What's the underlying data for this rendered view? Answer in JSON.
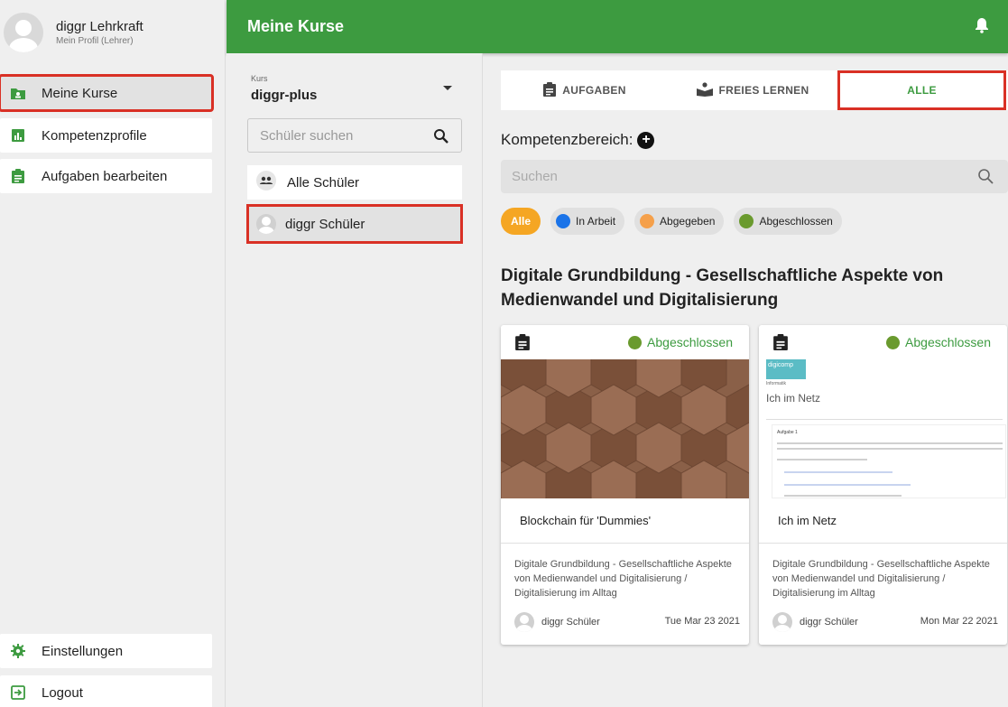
{
  "profile": {
    "name": "diggr Lehrkraft",
    "subtitle": "Mein Profil (Lehrer)"
  },
  "sidebar": {
    "items": [
      {
        "label": "Meine Kurse",
        "icon": "folder-person-icon"
      },
      {
        "label": "Kompetenzprofile",
        "icon": "bar-chart-icon"
      },
      {
        "label": "Aufgaben bearbeiten",
        "icon": "clipboard-icon"
      }
    ],
    "bottom": [
      {
        "label": "Einstellungen",
        "icon": "gear-icon"
      },
      {
        "label": "Logout",
        "icon": "logout-icon"
      }
    ]
  },
  "header": {
    "title": "Meine Kurse"
  },
  "course": {
    "label": "Kurs",
    "value": "diggr-plus"
  },
  "student_search": {
    "placeholder": "Schüler suchen"
  },
  "students": {
    "all": "Alle Schüler",
    "selected": "diggr Schüler"
  },
  "tabs": {
    "aufgaben": "AUFGABEN",
    "freies_lernen": "FREIES LERNEN",
    "alle": "ALLE"
  },
  "kompetenzbereich_label": "Kompetenzbereich:",
  "main_search": {
    "placeholder": "Suchen"
  },
  "filters": {
    "alle": "Alle",
    "in_arbeit": "In Arbeit",
    "abgegeben": "Abgegeben",
    "abgeschlossen": "Abgeschlossen"
  },
  "colors": {
    "green": "#3d9b40",
    "orange": "#f5a623",
    "blue": "#1a73e8",
    "highlight_red": "#d93025"
  },
  "section_title": "Digitale Grundbildung - Gesellschaftliche Aspekte von Medienwandel und Digitalisierung",
  "cards": [
    {
      "status": "Abgeschlossen",
      "title": "Blockchain für 'Dummies'",
      "description": "Digitale Grundbildung - Gesellschaftliche Aspekte von Medienwandel und Digitalisierung / Digitalisierung im Alltag",
      "student": "diggr Schüler",
      "date": "Tue Mar 23 2021"
    },
    {
      "status": "Abgeschlossen",
      "title": "Ich im Netz",
      "description": "Digitale Grundbildung - Gesellschaftliche Aspekte von Medienwandel und Digitalisierung / Digitalisierung im Alltag",
      "student": "diggr Schüler",
      "date": "Mon Mar 22 2021",
      "thumb": {
        "brand": "digicomp",
        "subject": "Informatik",
        "heading": "Ich im Netz",
        "task": "Aufgabe 1"
      }
    }
  ]
}
